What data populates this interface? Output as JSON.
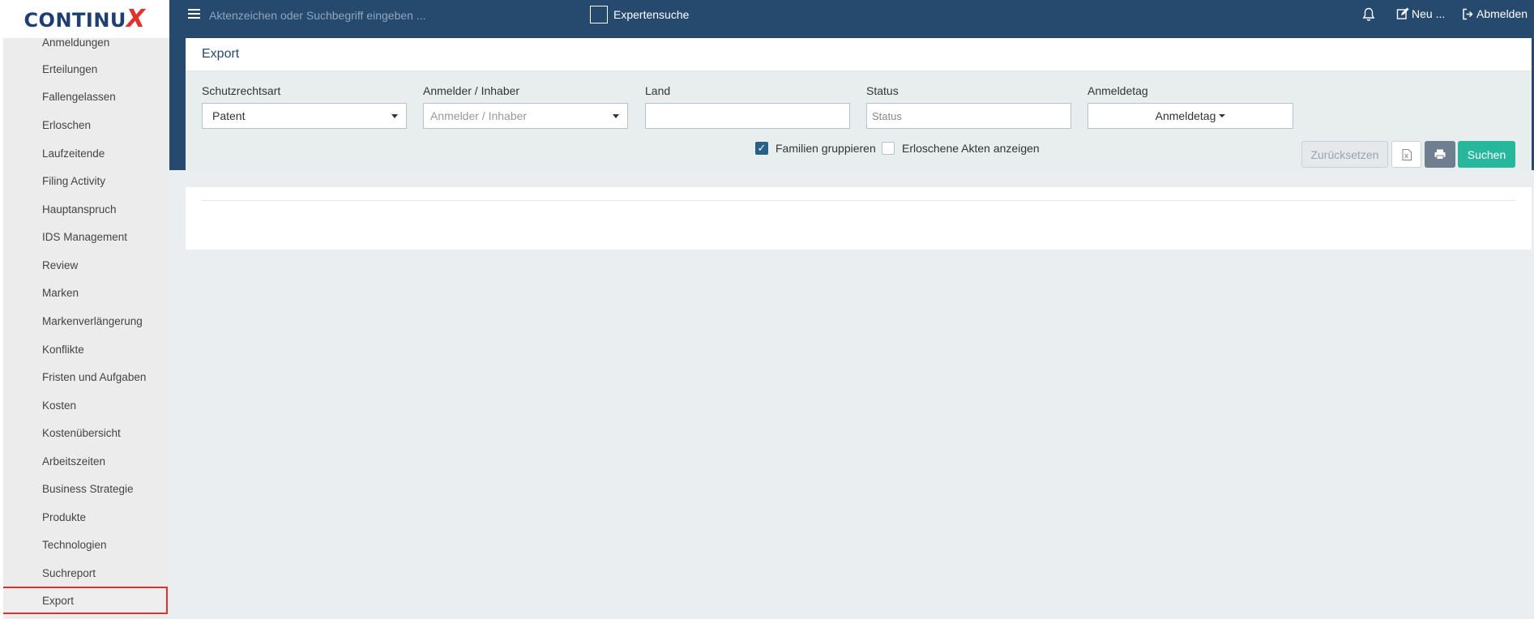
{
  "brand": {
    "logo_text": "CONTINU",
    "logo_x": "X"
  },
  "topbar": {
    "search_placeholder": "Aktenzeichen oder Suchbegriff eingeben ...",
    "expert_search_label": "Expertensuche",
    "new_label": "Neu ...",
    "logout_label": "Abmelden"
  },
  "sidebar": {
    "items": [
      {
        "label": "Anmeldungen"
      },
      {
        "label": "Erteilungen"
      },
      {
        "label": "Fallengelassen"
      },
      {
        "label": "Erloschen"
      },
      {
        "label": "Laufzeitende"
      },
      {
        "label": "Filing Activity"
      },
      {
        "label": "Hauptanspruch"
      },
      {
        "label": "IDS Management"
      },
      {
        "label": "Review"
      },
      {
        "label": "Marken"
      },
      {
        "label": "Markenverlängerung"
      },
      {
        "label": "Konflikte"
      },
      {
        "label": "Fristen und Aufgaben"
      },
      {
        "label": "Kosten"
      },
      {
        "label": "Kostenübersicht"
      },
      {
        "label": "Arbeitszeiten"
      },
      {
        "label": "Business Strategie"
      },
      {
        "label": "Produkte"
      },
      {
        "label": "Technologien"
      },
      {
        "label": "Suchreport"
      },
      {
        "label": "Export"
      }
    ],
    "active": "Export"
  },
  "export": {
    "title": "Export",
    "filters": {
      "schutzrechtsart": {
        "label": "Schutzrechtsart",
        "value": "Patent"
      },
      "anmelder": {
        "label": "Anmelder / Inhaber",
        "placeholder": "Anmelder / Inhaber"
      },
      "land": {
        "label": "Land",
        "value": ""
      },
      "status": {
        "label": "Status",
        "placeholder": "Status"
      },
      "anmeldetag": {
        "label": "Anmeldetag",
        "button_label": "Anmeldetag"
      }
    },
    "options": {
      "familien_gruppieren": {
        "label": "Familien gruppieren",
        "checked": true
      },
      "erloschene_akten": {
        "label": "Erloschene Akten anzeigen",
        "checked": false
      }
    },
    "buttons": {
      "reset": "Zurücksetzen",
      "search": "Suchen"
    }
  },
  "colors": {
    "navbar": "#264a6e",
    "search_button": "#26b79c",
    "print_button": "#6f7f90",
    "active_outline": "#e0312b"
  },
  "icons": {
    "menu": "hamburger-icon",
    "notifications": "bell-icon",
    "new": "edit-icon",
    "logout": "sign-out-icon",
    "excel": "excel-icon",
    "print": "print-icon"
  }
}
